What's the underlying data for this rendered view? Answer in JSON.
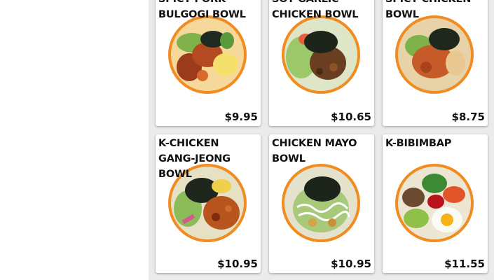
{
  "menu": {
    "items": [
      {
        "title": "SPICY PORK BULGOGI BOWL",
        "price": "$9.95",
        "image": "spicy-pork-bulgogi-bowl-photo"
      },
      {
        "title": "SOY GARLIC CHICKEN BOWL",
        "price": "$10.65",
        "image": "soy-garlic-chicken-bowl-photo"
      },
      {
        "title": "SPICY CHICKEN BOWL",
        "price": "$8.75",
        "image": "spicy-chicken-bowl-photo"
      },
      {
        "title": "K-CHICKEN GANG-JEONG BOWL",
        "price": "$10.95",
        "image": "k-chicken-gang-jeong-bowl-photo"
      },
      {
        "title": "CHICKEN MAYO BOWL",
        "price": "$10.95",
        "image": "chicken-mayo-bowl-photo"
      },
      {
        "title": "K-BIBIMBAP",
        "price": "$11.55",
        "image": "k-bibimbap-photo"
      }
    ]
  },
  "colors": {
    "background": "#ebebeb",
    "card": "#ffffff",
    "bowl_rim": "#f3a53a"
  }
}
